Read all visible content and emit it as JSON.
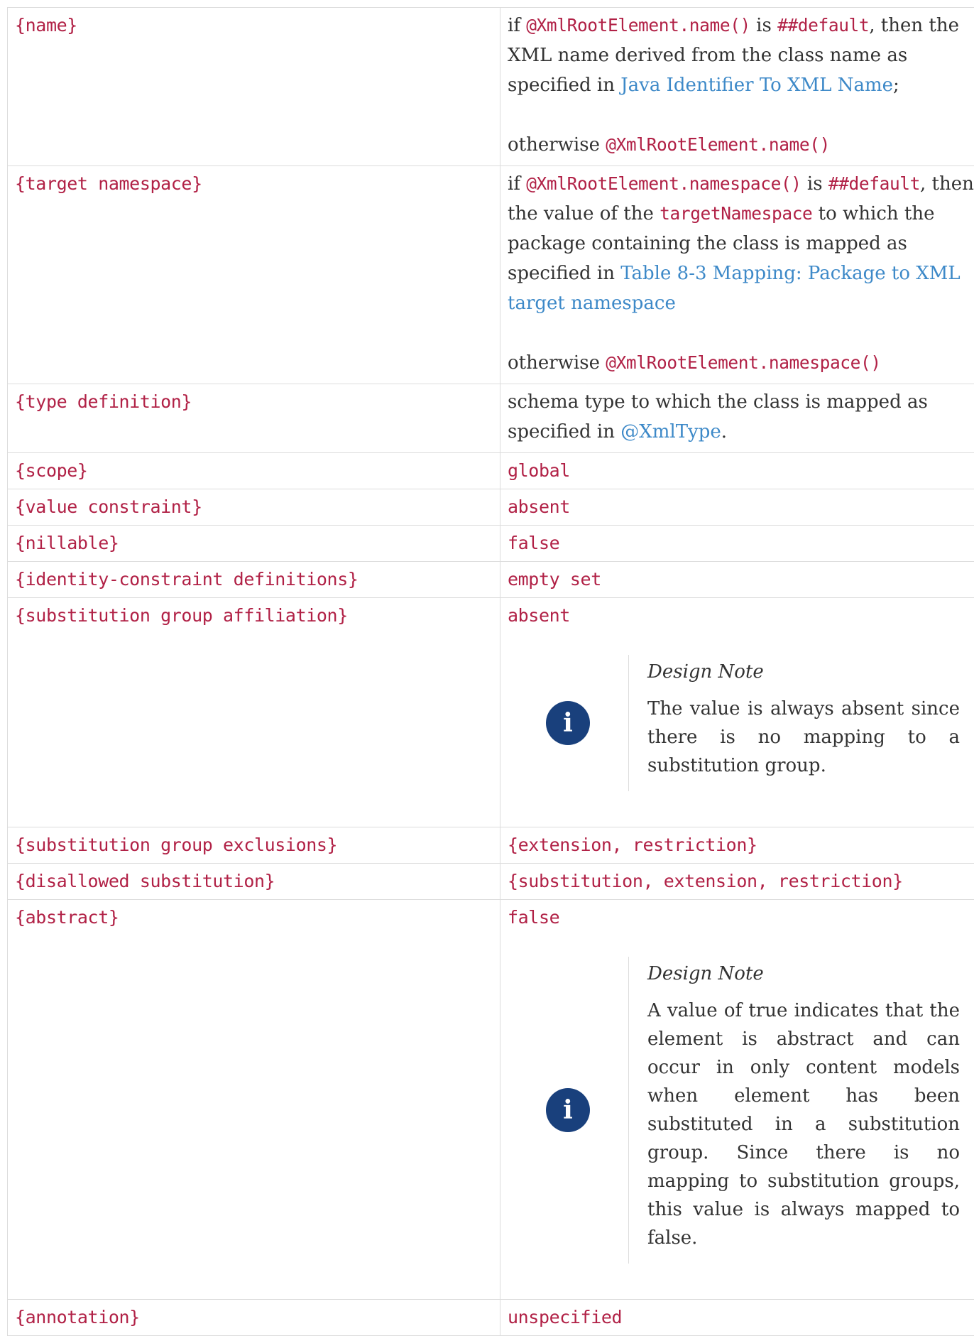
{
  "rows": {
    "name": {
      "property": "{name}",
      "p1_a": "if ",
      "p1_code1": "@XmlRootElement.name()",
      "p1_b": " is ",
      "p1_code2": "##default",
      "p1_c": ", then the XML name derived from the class name as specified in ",
      "p1_link": "Java Identifier To XML Name",
      "p1_d": ";",
      "p2_a": "otherwise ",
      "p2_code": "@XmlRootElement.name()"
    },
    "target_namespace": {
      "property": "{target namespace}",
      "p1_a": "if ",
      "p1_code1": "@XmlRootElement.namespace()",
      "p1_b": " is ",
      "p1_code2": "##default",
      "p1_c": ", then the value of the ",
      "p1_code3": "targetNamespace",
      "p1_d": " to which the package containing the class is mapped as specified in ",
      "p1_link": "Table 8-3 Mapping: Package to XML target namespace",
      "p2_a": "otherwise ",
      "p2_code": "@XmlRootElement.namespace()"
    },
    "type_definition": {
      "property": "{type definition}",
      "text": "schema type to which the class is mapped as specified in ",
      "link": "@XmlType",
      "end": "."
    },
    "scope": {
      "property": "{scope}",
      "value": "global"
    },
    "value_constraint": {
      "property": "{value constraint}",
      "value": "absent"
    },
    "nillable": {
      "property": "{nillable}",
      "value": "false"
    },
    "identity_constraint": {
      "property": "{identity-constraint definitions}",
      "value": "empty set"
    },
    "substitution_affiliation": {
      "property": "{substitution group affiliation}",
      "value": "absent",
      "note_icon": "info-icon",
      "note_title": "Design Note",
      "note_body": "The value is always absent since there is no mapping to a substitution group."
    },
    "substitution_exclusions": {
      "property": "{substitution group exclusions}",
      "value": "{extension, restriction}"
    },
    "disallowed_substitution": {
      "property": "{disallowed substitution}",
      "value": "{substitution, extension, restriction}"
    },
    "abstract": {
      "property": "{abstract}",
      "value": "false",
      "note_icon": "info-icon",
      "note_title": "Design Note",
      "note_body": "A value of true indicates that the element is abstract and can occur in only content models when element has been substituted in a substitution group. Since there is no mapping to substitution groups, this value is always mapped to false."
    },
    "annotation": {
      "property": "{annotation}",
      "value": "unspecified"
    }
  },
  "colors": {
    "code": "#b12146",
    "link": "#3d89c8",
    "text": "#333333",
    "border": "#dcdcdc",
    "note_icon_bg": "#19407c"
  }
}
